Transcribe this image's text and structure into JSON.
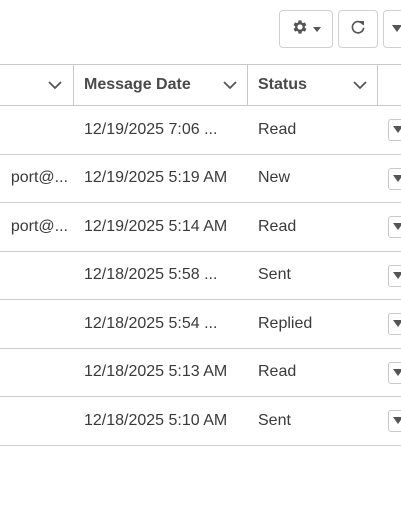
{
  "toolbar": {
    "settings_icon": "gear-icon",
    "settings_caret": "caret-down-icon",
    "refresh_icon": "refresh-icon",
    "more_icon": "caret-down-icon"
  },
  "grid": {
    "columns": [
      {
        "label": ""
      },
      {
        "label": "Message Date"
      },
      {
        "label": "Status"
      }
    ],
    "rows": [
      {
        "email": "",
        "date": "12/19/2025 7:06 ...",
        "status": "Read"
      },
      {
        "email": "port@...",
        "date": "12/19/2025 5:19 AM",
        "status": "New"
      },
      {
        "email": "port@...",
        "date": "12/19/2025 5:14 AM",
        "status": "Read"
      },
      {
        "email": "",
        "date": "12/18/2025 5:58 ...",
        "status": "Sent"
      },
      {
        "email": "",
        "date": "12/18/2025 5:54 ...",
        "status": "Replied"
      },
      {
        "email": "",
        "date": "12/18/2025 5:13 AM",
        "status": "Read"
      },
      {
        "email": "",
        "date": "12/18/2025 5:10 AM",
        "status": "Sent"
      }
    ]
  },
  "colors": {
    "border": "#c9c9c9",
    "text": "#3a3a3a",
    "header_text": "#4a4a4a",
    "icon": "#555555"
  }
}
